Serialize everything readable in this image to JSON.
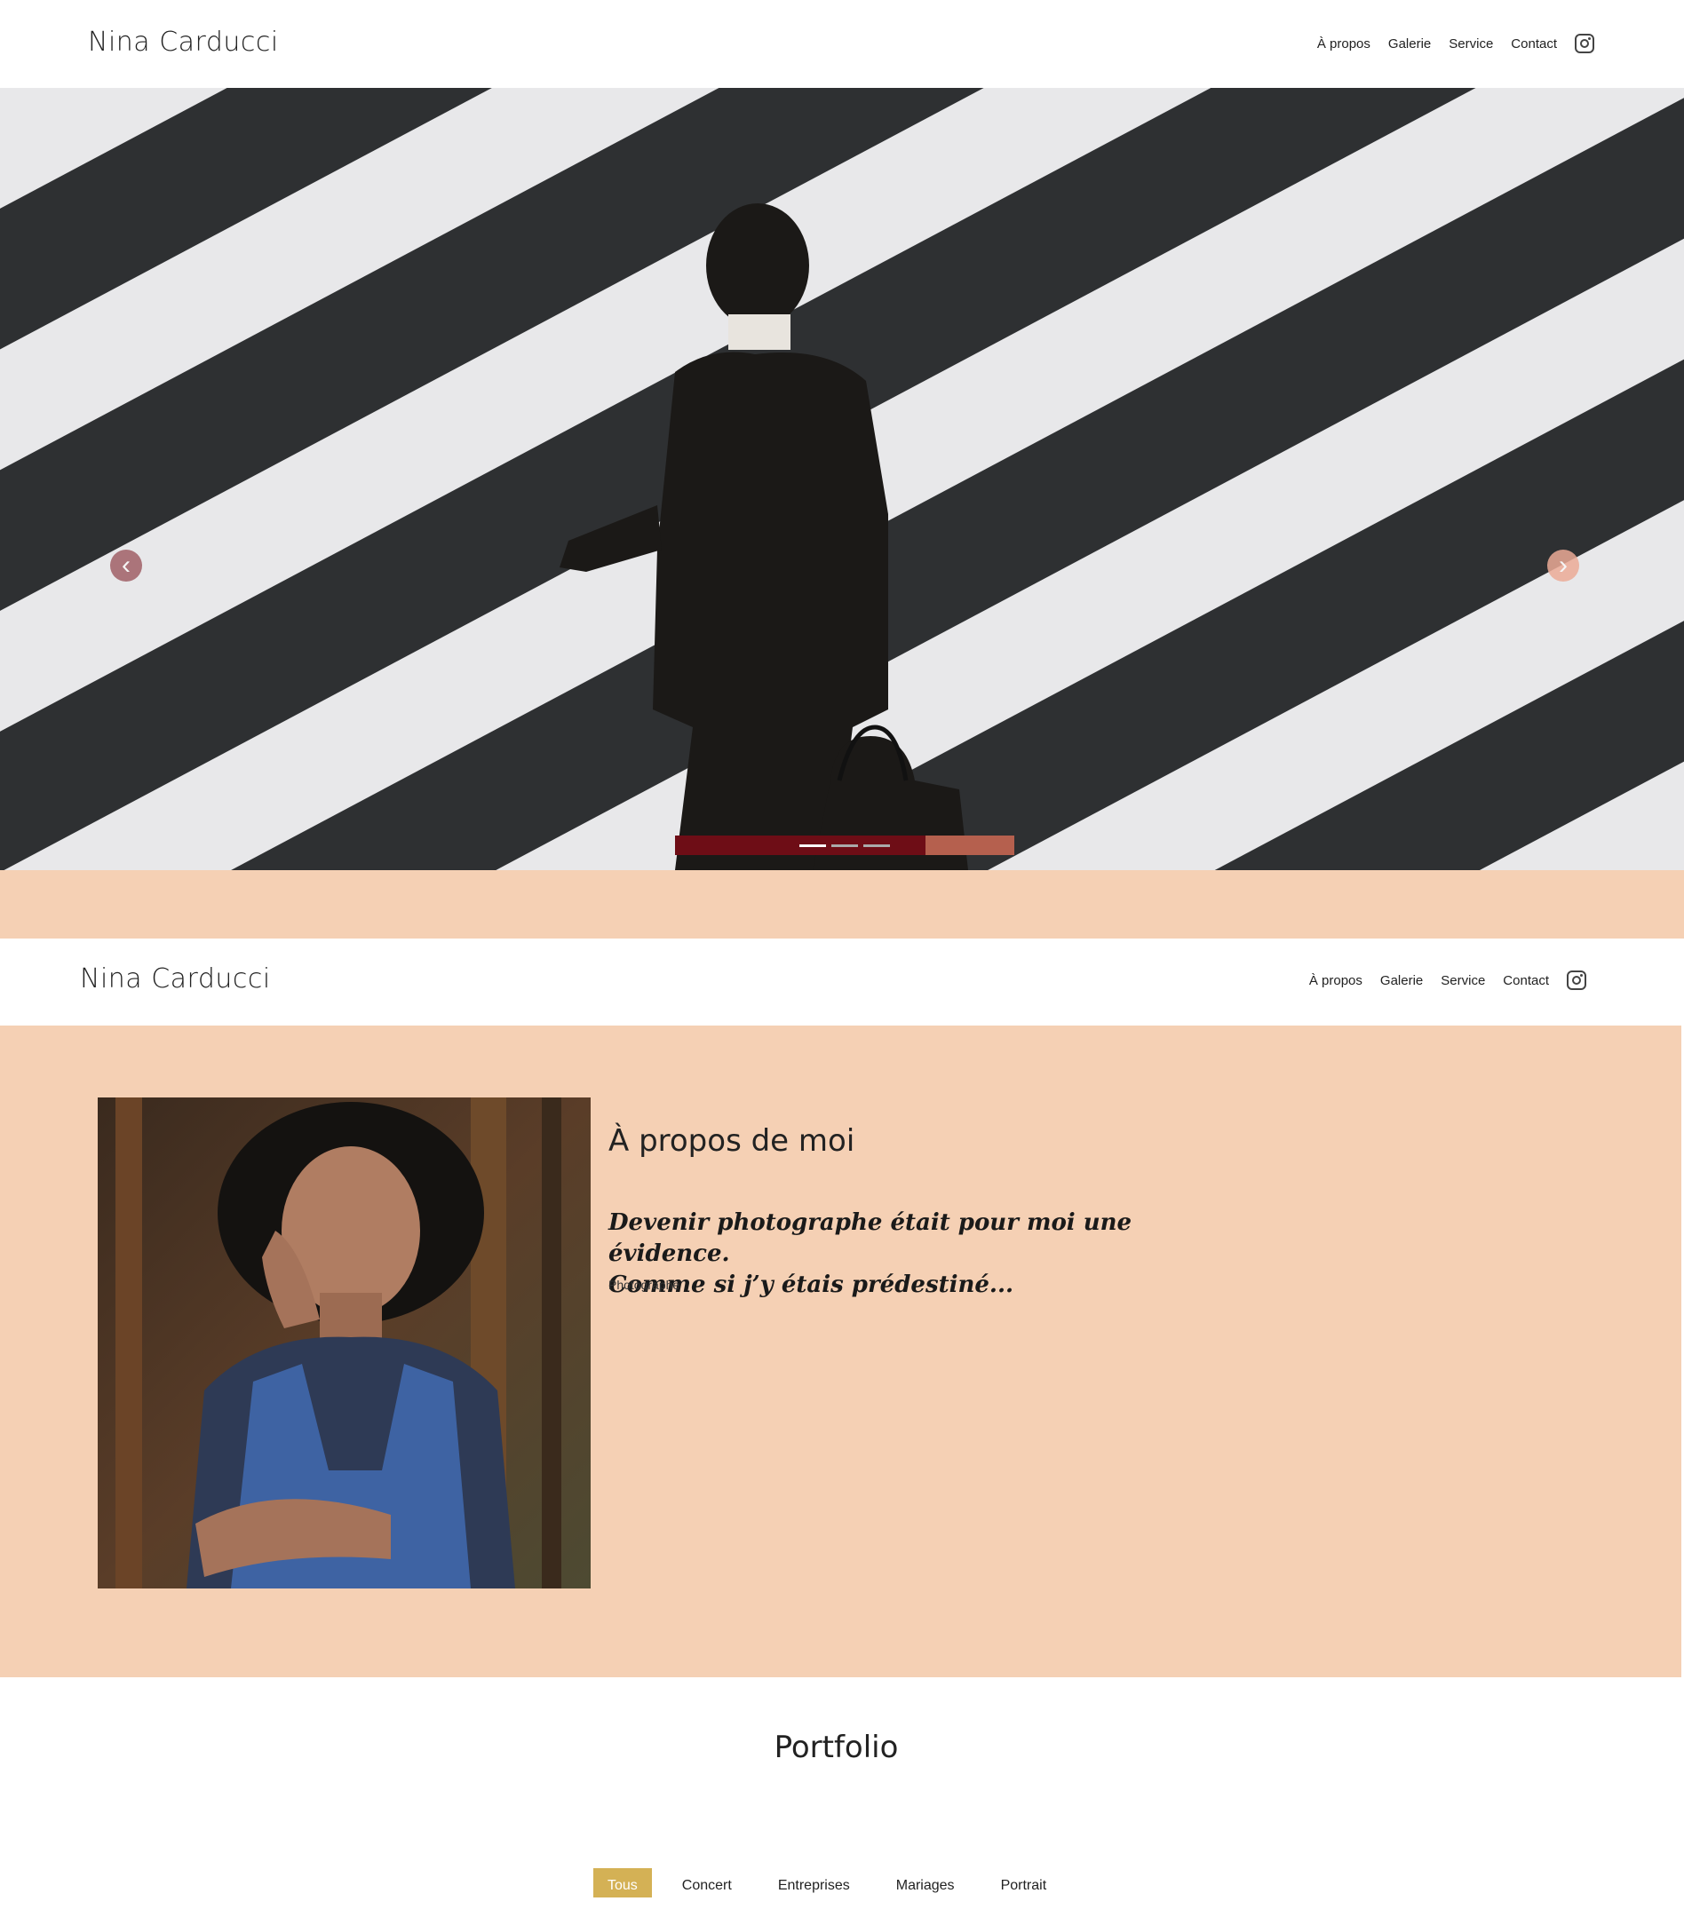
{
  "brand": "Nina Carducci",
  "nav": {
    "about": "À propos",
    "gallery": "Galerie",
    "service": "Service",
    "contact": "Contact",
    "instagram_icon": "instagram-icon"
  },
  "carousel": {
    "prev_icon": "chevron-left-icon",
    "next_icon": "chevron-right-icon",
    "prev_glyph": "‹",
    "next_glyph": "›",
    "slides": 3,
    "active_slide": 1
  },
  "about": {
    "title": "À propos de moi",
    "quote_line1": "Devenir photographe était pour moi une évidence.",
    "quote_line2": "Comme si j’y étais prédestiné...",
    "role": "Photographe"
  },
  "portfolio": {
    "title": "Portfolio",
    "filters": [
      "Tous",
      "Concert",
      "Entreprises",
      "Mariages",
      "Portrait"
    ],
    "active_filter": "Tous"
  },
  "colors": {
    "peach": "#f5d0b4",
    "gold": "#d4b155",
    "indicator_bar": "#6e0d16"
  }
}
